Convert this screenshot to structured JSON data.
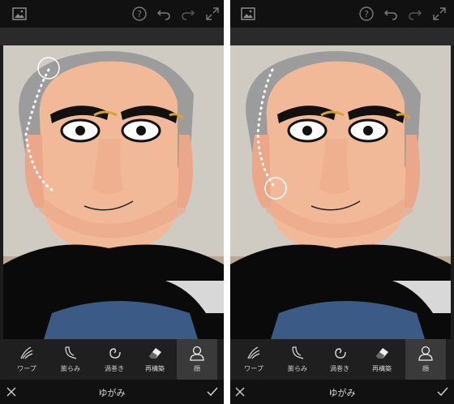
{
  "screens": [
    {
      "id": "left",
      "tools": [
        {
          "label": "ワープ",
          "icon": "warp-icon"
        },
        {
          "label": "膨らみ",
          "icon": "bulge-icon"
        },
        {
          "label": "渦巻き",
          "icon": "swirl-icon"
        },
        {
          "label": "再構築",
          "icon": "eraser-icon"
        },
        {
          "label": "顔",
          "icon": "face-icon"
        }
      ],
      "mode_title": "ゆがみ",
      "active_tool": "顔"
    },
    {
      "id": "right",
      "tools": [
        {
          "label": "ワープ",
          "icon": "warp-icon"
        },
        {
          "label": "膨らみ",
          "icon": "bulge-icon"
        },
        {
          "label": "渦巻き",
          "icon": "swirl-icon"
        },
        {
          "label": "再構築",
          "icon": "eraser-icon"
        },
        {
          "label": "顔",
          "icon": "face-icon"
        }
      ],
      "mode_title": "ゆがみ",
      "active_tool": "顔"
    }
  ],
  "top_icons": [
    "image-gallery-icon",
    "help-icon",
    "undo-icon",
    "redo-icon",
    "expand-icon"
  ],
  "bottom_icons": [
    "close-icon",
    "confirm-check-icon"
  ],
  "colors": {
    "bar_dark": "#111111",
    "toolbar": "#1f1f1f",
    "active_tool_bg": "#3a3a3a",
    "accent_white": "#ffffff"
  }
}
